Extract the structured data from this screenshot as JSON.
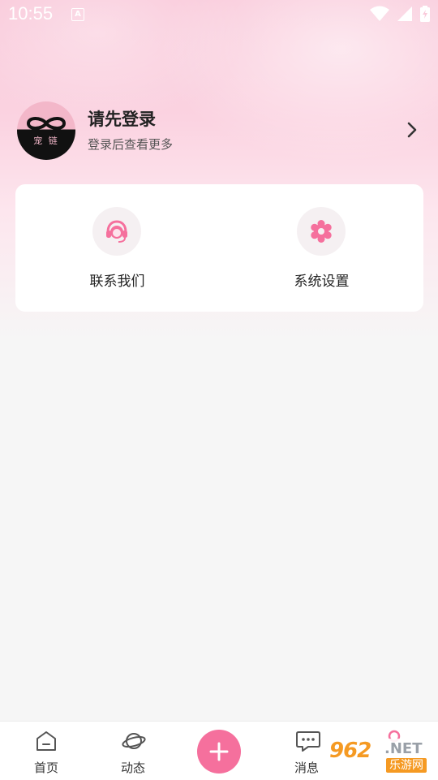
{
  "status_bar": {
    "time": "10:55",
    "a_badge": "A"
  },
  "profile": {
    "avatar_text": "宠 链",
    "title": "请先登录",
    "subtitle": "登录后查看更多"
  },
  "menu": {
    "contact_label": "联系我们",
    "settings_label": "系统设置"
  },
  "tabbar": {
    "home_label": "首页",
    "feed_label": "动态",
    "messages_label": "消息",
    "accent_color": "#f5709d"
  },
  "watermark": {
    "number": "962",
    "domain": ".NET",
    "site_name": "乐游网"
  }
}
